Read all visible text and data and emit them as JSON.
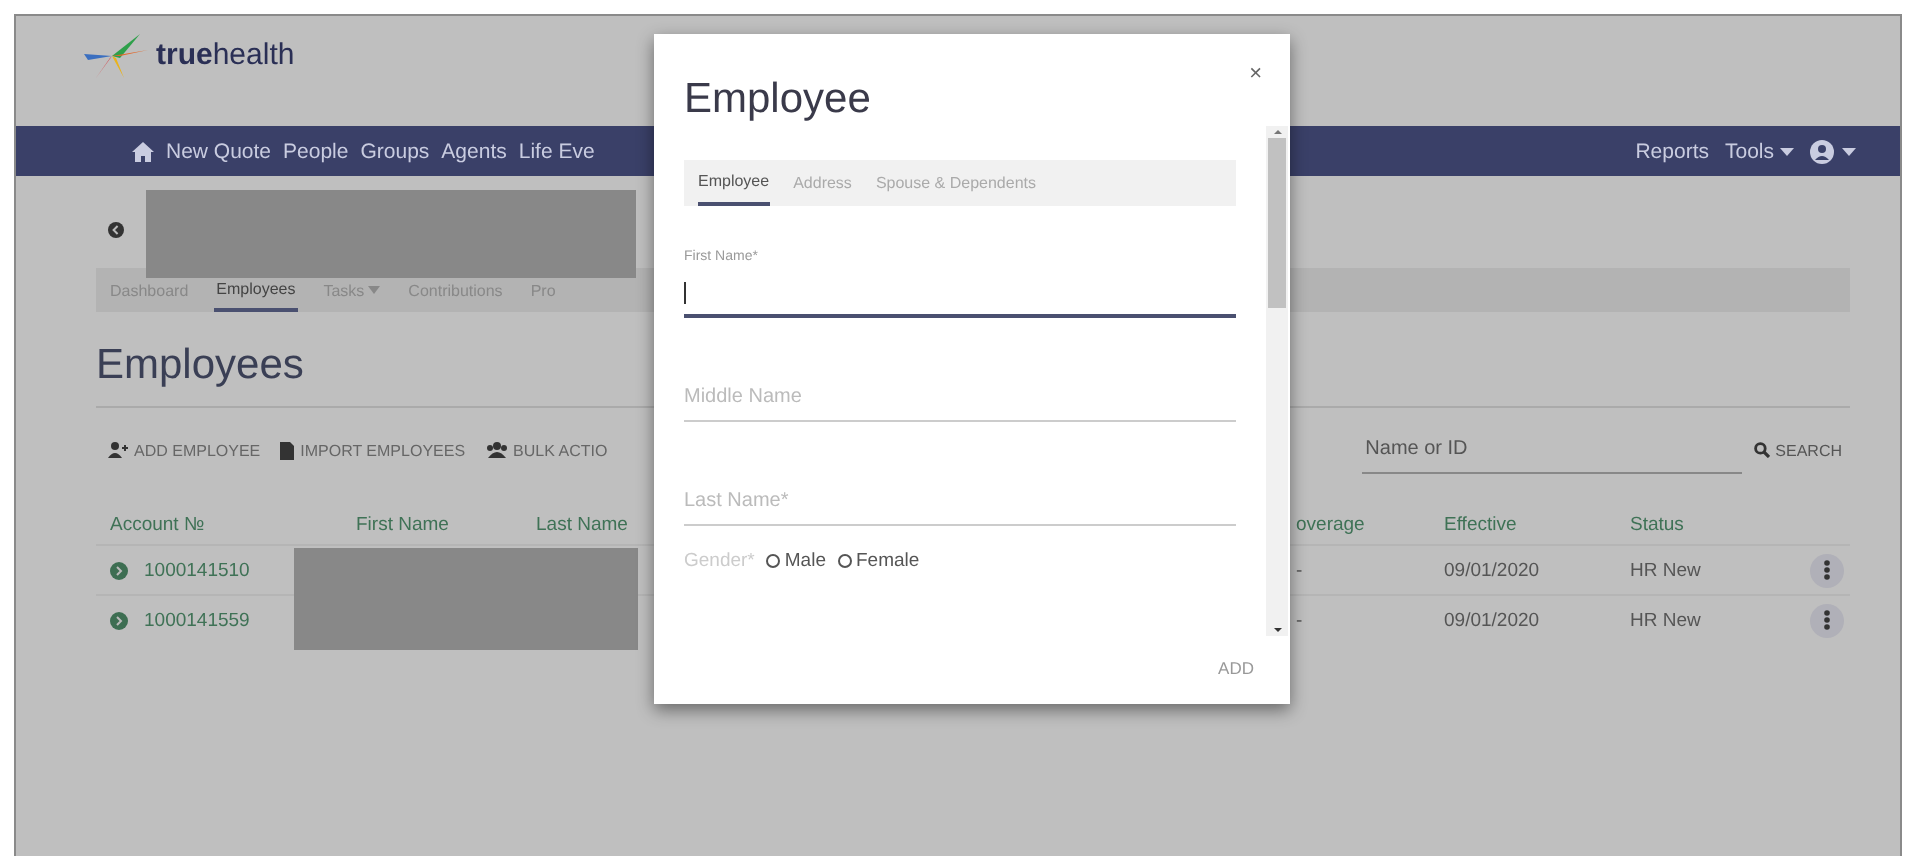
{
  "logo": "**true**health",
  "nav": {
    "left": [
      "New Quote",
      "People",
      "Groups",
      "Agents",
      "Life Eve"
    ],
    "right": [
      {
        "label": "Reports",
        "caret": false
      },
      {
        "label": "Tools",
        "caret": true
      }
    ],
    "user_caret": true
  },
  "subnav": [
    {
      "label": "Dashboard",
      "selected": false,
      "caret": false
    },
    {
      "label": "Employees",
      "selected": true,
      "caret": false
    },
    {
      "label": "Tasks",
      "selected": false,
      "caret": true
    },
    {
      "label": "Contributions",
      "selected": false,
      "caret": false
    },
    {
      "label": "Pro",
      "selected": false,
      "caret": false
    }
  ],
  "page_title": "Employees",
  "toolbar": [
    "ADD EMPLOYEE",
    "IMPORT EMPLOYEES",
    "BULK ACTIO"
  ],
  "search": {
    "placeholder": "Name or ID",
    "button": "SEARCH"
  },
  "table": {
    "columns": [
      "Account №",
      "First Name",
      "Last Name",
      "overage",
      "Effective",
      "Status"
    ],
    "rows": [
      {
        "account": "1000141510",
        "coverage": "-",
        "effective": "09/01/2020",
        "status": "HR New"
      },
      {
        "account": "1000141559",
        "coverage": "-",
        "effective": "09/01/2020",
        "status": "HR New"
      }
    ]
  },
  "modal": {
    "title": "Employee",
    "close": "×",
    "tabs": [
      {
        "label": "Employee",
        "selected": true
      },
      {
        "label": "Address",
        "selected": false
      },
      {
        "label": "Spouse & Dependents",
        "selected": false
      }
    ],
    "fields": [
      {
        "kind": "text",
        "label": "First Name*",
        "focused": true
      },
      {
        "kind": "text",
        "placeholder": "Middle Name",
        "focused": false
      },
      {
        "kind": "text",
        "placeholder": "Last Name*",
        "focused": false
      },
      {
        "kind": "radio",
        "label": "Gender*",
        "options": [
          {
            "label": "Male",
            "selected": false
          },
          {
            "label": "Female",
            "selected": false
          }
        ]
      }
    ],
    "action": "ADD"
  }
}
